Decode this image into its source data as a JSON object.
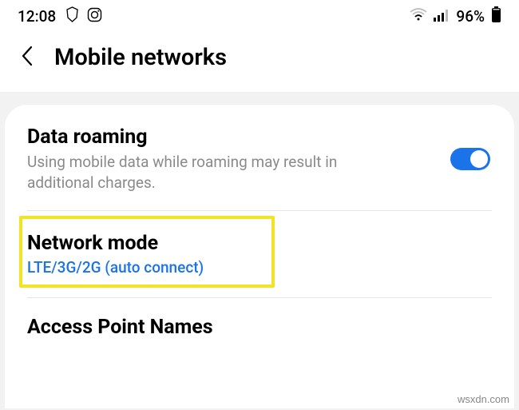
{
  "statusbar": {
    "time": "12:08",
    "battery_pct": "96%"
  },
  "header": {
    "title": "Mobile networks"
  },
  "rows": {
    "roaming": {
      "title": "Data roaming",
      "sub": "Using mobile data while roaming may result in additional charges."
    },
    "network_mode": {
      "title": "Network mode",
      "value": "LTE/3G/2G (auto connect)"
    },
    "apn": {
      "title": "Access Point Names"
    }
  },
  "watermark": "wsxdn.com"
}
